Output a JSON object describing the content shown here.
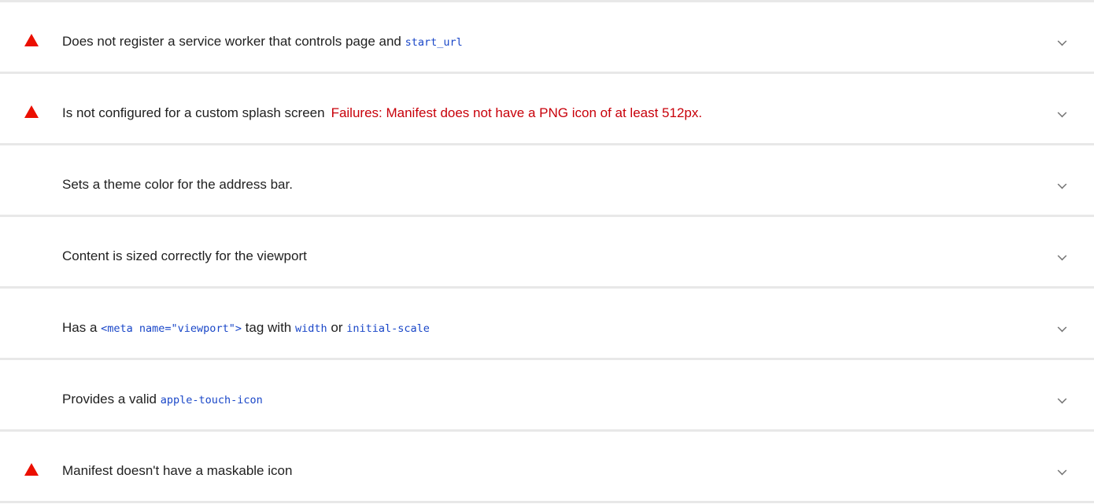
{
  "audits": [
    {
      "status": "fail",
      "segments": [
        {
          "text": "Does not register a service worker that controls page and ",
          "style": "plain"
        },
        {
          "text": "start_url",
          "style": "code"
        }
      ]
    },
    {
      "status": "fail",
      "segments": [
        {
          "text": "Is not configured for a custom splash screen",
          "style": "plain"
        },
        {
          "text": "Failures: Manifest does not have a PNG icon of at least 512px.",
          "style": "failure"
        }
      ]
    },
    {
      "status": "manual",
      "segments": [
        {
          "text": "Sets a theme color for the address bar.",
          "style": "plain"
        }
      ]
    },
    {
      "status": "manual",
      "segments": [
        {
          "text": "Content is sized correctly for the viewport",
          "style": "plain"
        }
      ]
    },
    {
      "status": "manual",
      "segments": [
        {
          "text": "Has a ",
          "style": "plain"
        },
        {
          "text": "<meta name=\"viewport\">",
          "style": "code"
        },
        {
          "text": " tag with ",
          "style": "plain"
        },
        {
          "text": "width",
          "style": "code"
        },
        {
          "text": " or ",
          "style": "plain"
        },
        {
          "text": "initial-scale",
          "style": "code"
        }
      ]
    },
    {
      "status": "manual",
      "segments": [
        {
          "text": "Provides a valid ",
          "style": "plain"
        },
        {
          "text": "apple-touch-icon",
          "style": "code"
        }
      ]
    },
    {
      "status": "fail",
      "segments": [
        {
          "text": "Manifest doesn't have a maskable icon",
          "style": "plain"
        }
      ]
    }
  ],
  "colors": {
    "fail": "#eb0f00",
    "failure_text": "#c8000a",
    "code": "#1a47c8",
    "divider": "#e8e8e8",
    "chevron": "#757575"
  },
  "icons": {
    "fail": "warning-triangle-icon",
    "toggle": "chevron-down-icon"
  }
}
